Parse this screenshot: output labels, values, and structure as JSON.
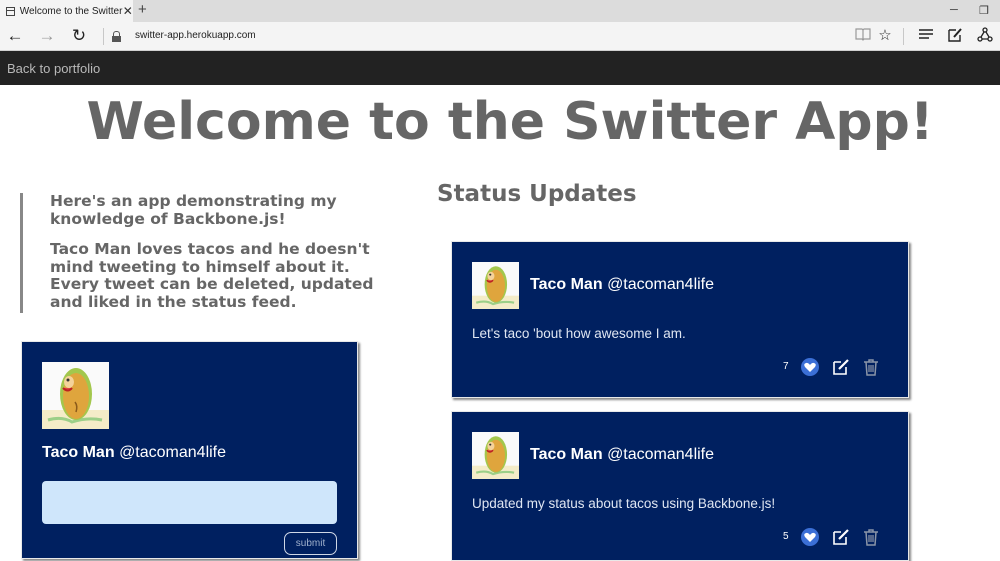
{
  "browser": {
    "tab_title": "Welcome to the Switter",
    "url": "switter-app.herokuapp.com"
  },
  "nav": {
    "back_link": "Back to portfolio"
  },
  "page": {
    "title": "Welcome to the Switter App!",
    "intro": [
      "Here's an app demonstrating my knowledge of Backbone.js!",
      "Taco Man loves tacos and he doesn't mind tweeting to himself about it. Every tweet can be deleted, updated and liked in the status feed."
    ],
    "status_heading": "Status Updates"
  },
  "compose": {
    "name": "Taco Man",
    "handle": "@tacoman4life",
    "submit_label": "submit"
  },
  "posts": [
    {
      "name": "Taco Man",
      "handle": "@tacoman4life",
      "text": "Let's taco 'bout how awesome I am.",
      "likes": "7"
    },
    {
      "name": "Taco Man",
      "handle": "@tacoman4life",
      "text": "Updated my status about tacos using Backbone.js!",
      "likes": "5"
    }
  ],
  "colors": {
    "card": "#002060",
    "nav": "#222222",
    "heading": "#666666",
    "input": "#cfe6fb"
  },
  "icons": [
    "tab-page-icon",
    "close-icon",
    "new-tab-icon",
    "back-icon",
    "forward-icon",
    "refresh-icon",
    "lock-icon",
    "reading-view-icon",
    "favorite-star-icon",
    "hub-icon",
    "web-note-icon",
    "share-icon",
    "taco-avatar-icon",
    "heart-icon",
    "edit-icon",
    "trash-icon"
  ]
}
